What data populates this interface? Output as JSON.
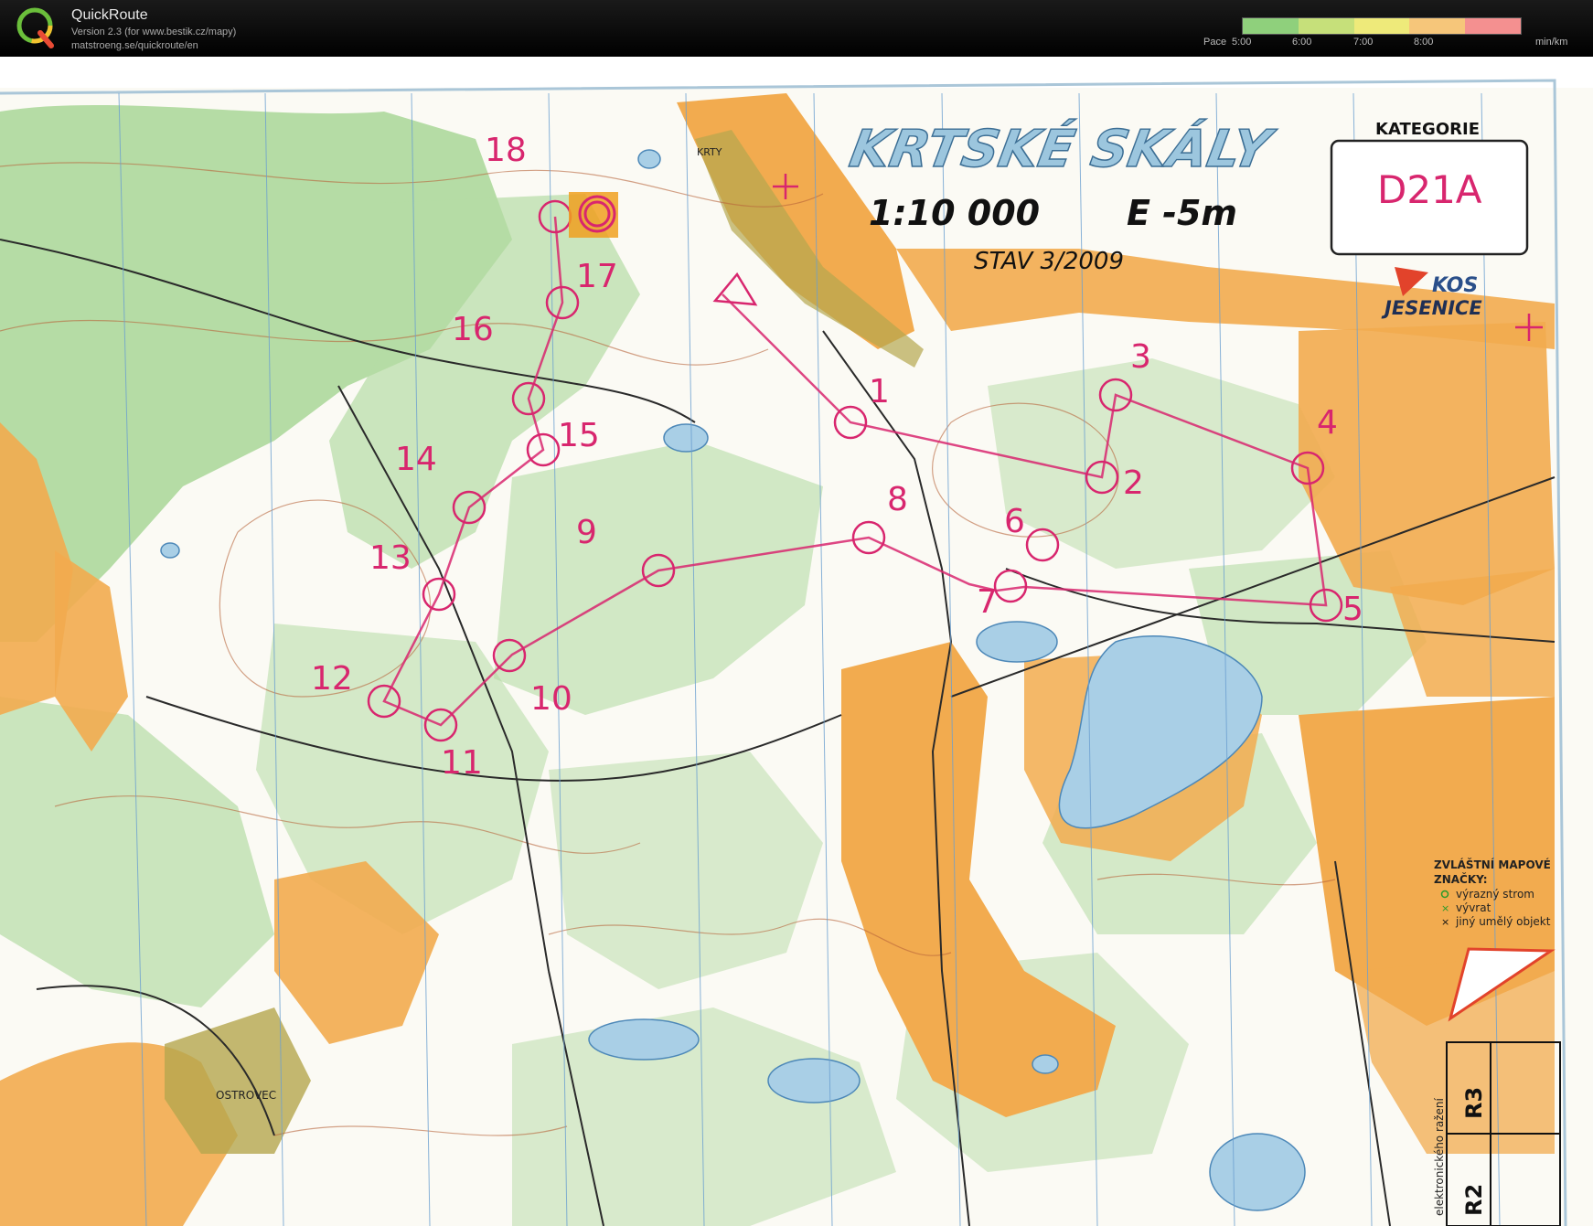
{
  "header": {
    "app_name": "QuickRoute",
    "version": "Version 2.3  (for www.bestik.cz/mapy)",
    "url": "matstroeng.se/quickroute/en",
    "logo_letter": "Q"
  },
  "pace_scale": {
    "prefix": "Pace",
    "ticks": [
      "5:00",
      "6:00",
      "7:00",
      "8:00"
    ],
    "unit": "min/km",
    "gradient_colors": [
      "#8fd07c",
      "#c6e07a",
      "#eeea7a",
      "#f6c67a",
      "#f49090"
    ]
  },
  "map": {
    "title": "KRTSKÉ SKÁLY",
    "scale": "1:10 000",
    "equidistance": "E -5m",
    "status": "STAV 3/2009",
    "category_label": "KATEGORIE",
    "category_value": "D21A",
    "club_logo_top": "KOS",
    "club_logo_bottom": "JESENICE",
    "village_top": "KRTY",
    "village_bottom": "OSTROVEC",
    "legend": {
      "heading_line1": "ZVLÁŠTNÍ MAPOVÉ",
      "heading_line2": "ZNAČKY:",
      "items": [
        "výrazný strom",
        "vývrat",
        "jiný umělý objekt"
      ]
    },
    "side_labels": [
      "R3",
      "R2"
    ],
    "side_note": "elektronického ražení",
    "control_numbers": [
      "1",
      "2",
      "3",
      "4",
      "5",
      "6",
      "7",
      "8",
      "9",
      "10",
      "11",
      "12",
      "13",
      "14",
      "15",
      "16",
      "17",
      "18"
    ],
    "colors": {
      "course": "#d8266e",
      "forest_green": "#9bd08a",
      "open_orange": "#f0a94a",
      "water_blue": "#a9cfe6",
      "title_blue": "#9cc6de"
    }
  }
}
